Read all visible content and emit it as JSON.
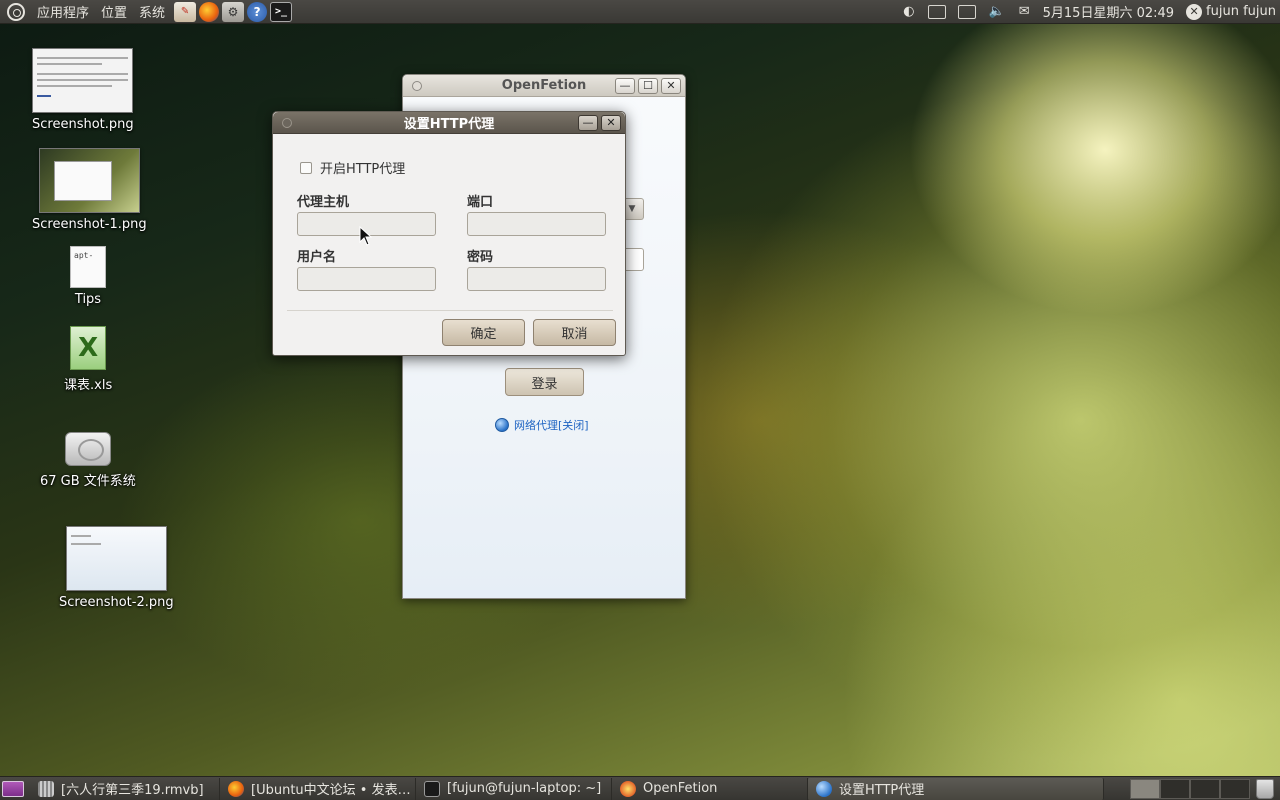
{
  "top_panel": {
    "menus": [
      "应用程序",
      "位置",
      "系统"
    ],
    "launchers": [
      {
        "icon": "text-editor-icon",
        "glyph": "✎"
      },
      {
        "icon": "firefox-icon",
        "glyph": ""
      },
      {
        "icon": "system-monitor-icon",
        "glyph": "⚙"
      },
      {
        "icon": "help-icon",
        "glyph": "?"
      },
      {
        "icon": "terminal-icon",
        "glyph": ">_"
      }
    ],
    "clock": "5月15日星期六 02:49",
    "user": "fujun fujun",
    "user_icon_glyph": "✕"
  },
  "desktop_icons": [
    {
      "label": "Screenshot.png"
    },
    {
      "label": "Screenshot-1.png"
    },
    {
      "label": "Tips",
      "doc_text": "apt-"
    },
    {
      "label": "课表.xls",
      "glyph": "X"
    },
    {
      "label": "67 GB 文件系统"
    },
    {
      "label": "Screenshot-2.png"
    }
  ],
  "fetion_window": {
    "title": "OpenFetion",
    "min_glyph": "—",
    "max_glyph": "☐",
    "close_glyph": "✕",
    "combo_arrow": "▼",
    "login_label": "登录",
    "proxy_link": "网络代理[关闭]"
  },
  "proxy_dialog": {
    "title": "设置HTTP代理",
    "min_glyph": "—",
    "close_glyph": "✕",
    "enable_label": "开启HTTP代理",
    "enable_checked": false,
    "host_label": "代理主机",
    "port_label": "端口",
    "user_label": "用户名",
    "password_label": "密码",
    "host_value": "",
    "port_value": "",
    "user_value": "",
    "password_value": "",
    "ok_label": "确定",
    "cancel_label": "取消"
  },
  "taskbar": {
    "tasks": [
      {
        "label": "[六人行第三季19.rmvb]",
        "icon": "video-icon",
        "active": false
      },
      {
        "label": "[Ubuntu中文论坛 • 发表…",
        "icon": "firefox-icon",
        "active": false
      },
      {
        "label": "[fujun@fujun-laptop: ~]",
        "icon": "terminal-icon",
        "active": false
      },
      {
        "label": "OpenFetion",
        "icon": "fetion-icon",
        "active": false
      },
      {
        "label": "设置HTTP代理",
        "icon": "globe-icon",
        "active": true
      }
    ]
  }
}
